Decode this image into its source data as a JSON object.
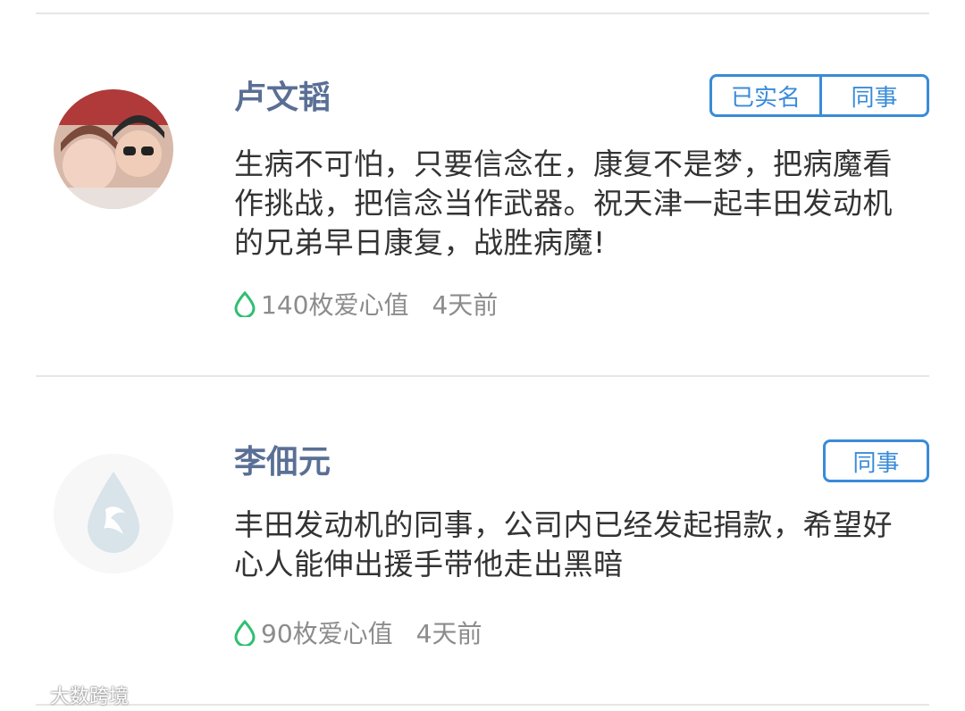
{
  "comments": [
    {
      "name": "卢文韬",
      "tags": [
        "已实名",
        "同事"
      ],
      "message": "生病不可怕，只要信念在，康复不是梦，把病魔看作挑战，把信念当作武器。祝天津一起丰田发动机的兄弟早日康复，战胜病魔!",
      "love": "140枚爱心值",
      "time": "4天前",
      "avatar": "photo-avatar"
    },
    {
      "name": "李佃元",
      "tags": [
        "同事"
      ],
      "message": "丰田发动机的同事，公司内已经发起捐款，希望好心人能伸出援手带他走出黑暗",
      "love": "90枚爱心值",
      "time": "4天前",
      "avatar": "default-drop-avatar"
    }
  ],
  "watermark": "大数跨境",
  "colors": {
    "accent": "#3a8bd8",
    "name": "#5a6f95",
    "love_icon": "#2fbf71"
  }
}
